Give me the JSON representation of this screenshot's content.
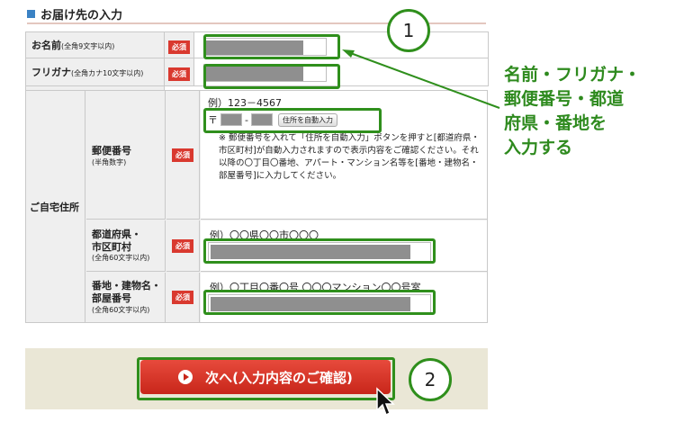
{
  "section": {
    "title": "お届け先の入力"
  },
  "required_label": "必須",
  "name": {
    "label": "お名前",
    "hint": "(全角9文字以内)"
  },
  "kana": {
    "label": "フリガナ",
    "hint": "(全角カナ10文字以内)"
  },
  "home_address": {
    "label": "ご自宅住所"
  },
  "postal": {
    "label": "郵便番号",
    "hint": "(半角数字)",
    "example": "例）123－4567",
    "mark": "〒",
    "dash": "-",
    "auto_button": "住所を自動入力",
    "note": "※ 郵便番号を入れて「住所を自動入力」ボタンを押すと[都道府県・市区町村]が自動入力されますので表示内容をご確認ください。それ以降の〇丁目〇番地、アパート・マンション名等を[番地・建物名・部屋番号]に入力してください。"
  },
  "prefecture": {
    "label1": "都道府県・",
    "label2": "市区町村",
    "hint": "(全角60文字以内)",
    "example": "例）〇〇県〇〇市〇〇〇"
  },
  "street": {
    "label1": "番地・建物名・",
    "label2": "部屋番号",
    "hint": "(全角60文字以内)",
    "example": "例）〇丁目〇番〇号 〇〇〇マンション〇〇号室"
  },
  "annotation": {
    "line1": "名前・フリガナ・",
    "line2": "郵便番号・都道",
    "line3": "府県・番地を",
    "line4": "入力する"
  },
  "step1": "1",
  "step2": "2",
  "next_button": {
    "label": "次へ(入力内容のご確認)"
  },
  "colors": {
    "highlight": "#2f8f1c",
    "badge": "#d9392f",
    "button": "#d0342a"
  }
}
